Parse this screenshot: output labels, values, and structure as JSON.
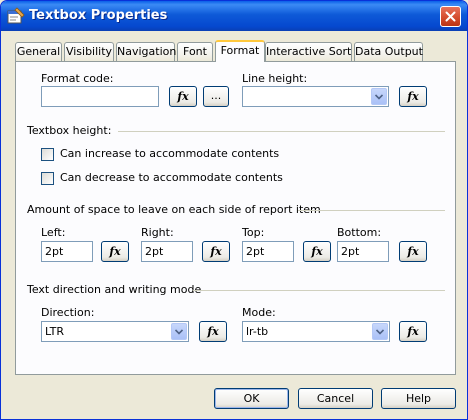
{
  "window": {
    "title": "Textbox Properties"
  },
  "tabs": [
    {
      "label": "General"
    },
    {
      "label": "Visibility"
    },
    {
      "label": "Navigation"
    },
    {
      "label": "Font"
    },
    {
      "label": "Format",
      "active": true
    },
    {
      "label": "Interactive Sort"
    },
    {
      "label": "Data Output"
    }
  ],
  "format": {
    "format_code_label": "Format code:",
    "format_code_value": "",
    "fx_label": "fx",
    "dots_label": "...",
    "line_height_label": "Line height:",
    "line_height_value": ""
  },
  "textbox_height": {
    "heading": "Textbox height:",
    "can_increase": {
      "label": "Can increase to accommodate contents",
      "checked": false
    },
    "can_decrease": {
      "label": "Can decrease to accommodate contents",
      "checked": false
    }
  },
  "spacing": {
    "heading": "Amount of space to leave on each side of report item",
    "left": {
      "label": "Left:",
      "value": "2pt"
    },
    "right": {
      "label": "Right:",
      "value": "2pt"
    },
    "top": {
      "label": "Top:",
      "value": "2pt"
    },
    "bottom": {
      "label": "Bottom:",
      "value": "2pt"
    }
  },
  "direction": {
    "heading": "Text direction and writing mode",
    "direction_label": "Direction:",
    "direction_value": "LTR",
    "mode_label": "Mode:",
    "mode_value": "lr-tb"
  },
  "buttons": {
    "ok": "OK",
    "cancel": "Cancel",
    "help": "Help"
  },
  "colors": {
    "title_bar": "#0548cf",
    "active_tab_accent": "#ffc83c",
    "dialog_bg": "#ece9d8"
  }
}
